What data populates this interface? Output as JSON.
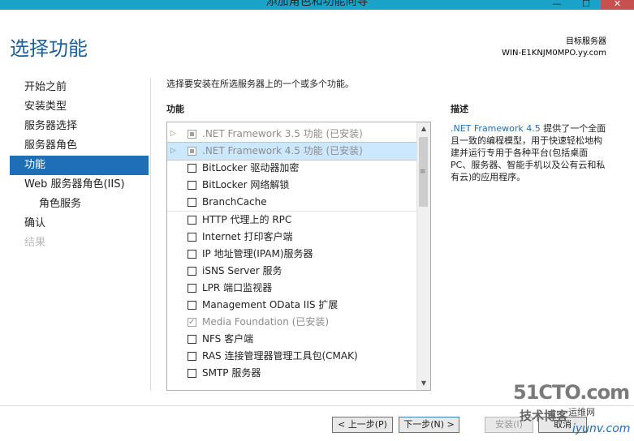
{
  "window": {
    "title": "添加角色和功能向导",
    "min": "—",
    "max": "☐",
    "close": "✕"
  },
  "header": {
    "title": "选择功能",
    "server_label": "目标服务器",
    "server_name": "WIN-E1KNJM0MPO.yy.com"
  },
  "nav": {
    "items": [
      {
        "label": "开始之前"
      },
      {
        "label": "安装类型"
      },
      {
        "label": "服务器选择"
      },
      {
        "label": "服务器角色"
      },
      {
        "label": "功能"
      },
      {
        "label": "Web 服务器角色(IIS)"
      },
      {
        "label": "角色服务"
      },
      {
        "label": "确认"
      },
      {
        "label": "结果"
      }
    ]
  },
  "main": {
    "instruction": "选择要安装在所选服务器上的一个或多个功能。",
    "features_header": "功能",
    "description_header": "描述",
    "features": [
      {
        "label": ".NET Framework 3.5 功能 (已安装)"
      },
      {
        "label": ".NET Framework 4.5 功能 (已安装)"
      },
      {
        "label": "BitLocker 驱动器加密"
      },
      {
        "label": "BitLocker 网络解锁"
      },
      {
        "label": "BranchCache"
      },
      {
        "label": "HTTP 代理上的 RPC"
      },
      {
        "label": "Internet 打印客户端"
      },
      {
        "label": "IP 地址管理(IPAM)服务器"
      },
      {
        "label": "iSNS Server 服务"
      },
      {
        "label": "LPR 端口监视器"
      },
      {
        "label": "Management OData IIS 扩展"
      },
      {
        "label": "Media Foundation (已安装)"
      },
      {
        "label": "NFS 客户端"
      },
      {
        "label": "RAS 连接管理器管理工具包(CMAK)"
      },
      {
        "label": "SMTP 服务器"
      }
    ],
    "scroll_up": "▲",
    "scroll_down": "▼",
    "description": {
      "highlight": ".NET Framework 4.5",
      "text": " 提供了一个全面且一致的编程模型，用于快速轻松地构建并运行专用于各种平台(包括桌面 PC、服务器、智能手机以及公有云和私有云)的应用程序。"
    }
  },
  "footer": {
    "prev_label": "< 上一步(P)",
    "next_label": "下一步(N) >",
    "install_label": "安装(I)",
    "cancel_label": "取消"
  },
  "watermark": {
    "big": "51CTO.com",
    "small": "技术博客",
    "blog": "运维网",
    "url": "iyunv.com"
  },
  "colors": {
    "accent": "#1e6fb5",
    "titlebar": "#1aa3c9",
    "selection": "#cce8ff"
  }
}
